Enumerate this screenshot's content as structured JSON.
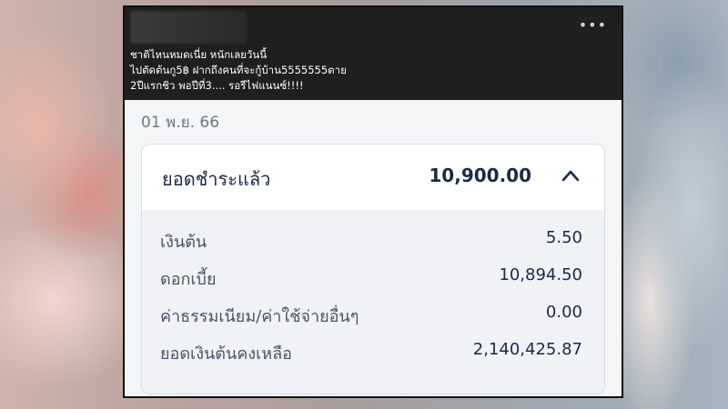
{
  "post": {
    "caption_lines": [
      "ชาติไหนหมดเนี่ย หนักเลยวันนี้",
      "ไปตัดต้นกู5฿ ฝากถึงคนที่จะกู้บ้าน5555555ตาย",
      "2ปีแรกชิว พอปีที่3.... รอรีไฟแนนซ์!!!!"
    ],
    "more_icon": "more-horizontal-icon"
  },
  "statement": {
    "date": "01 พ.ย. 66",
    "paid_label": "ยอดชำระแล้ว",
    "paid_amount": "10,900.00",
    "toggle_icon": "chevron-up-icon",
    "rows": [
      {
        "label": "เงินต้น",
        "value": "5.50"
      },
      {
        "label": "ดอกเบี้ย",
        "value": "10,894.50"
      },
      {
        "label": "ค่าธรรมเนียม/ค่าใช้จ่ายอื่นๆ",
        "value": "0.00"
      },
      {
        "label": "ยอดเงินต้นคงเหลือ",
        "value": "2,140,425.87"
      }
    ]
  },
  "colors": {
    "header_bg": "#1f1f1f",
    "text_primary": "#1b2a44",
    "text_secondary": "#4a5563",
    "card_body_bg": "#f0f2f5"
  }
}
